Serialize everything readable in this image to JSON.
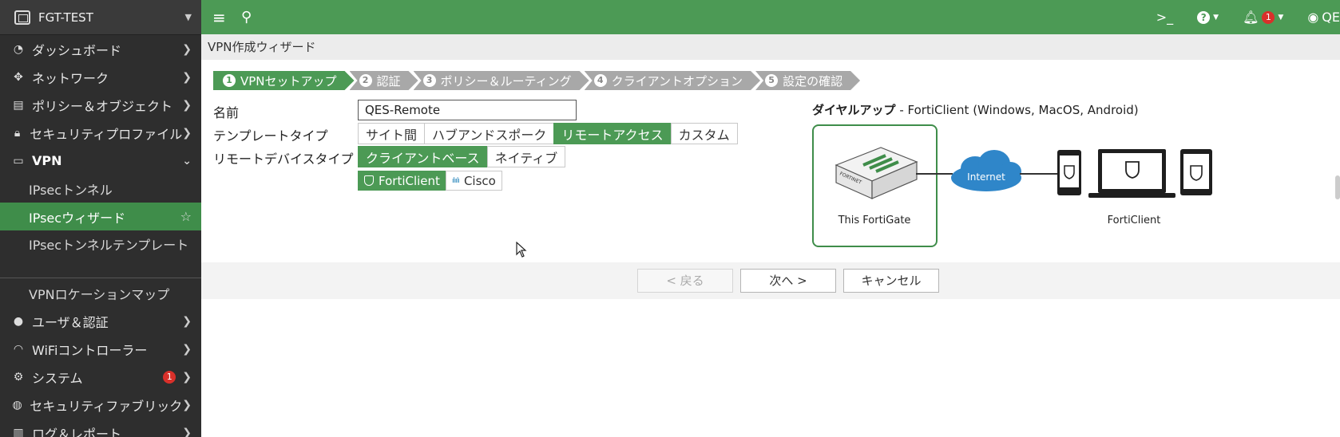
{
  "sidebar": {
    "device_name": "FGT-TEST",
    "items": [
      {
        "label": "ダッシュボード",
        "icon": "dashboard-icon"
      },
      {
        "label": "ネットワーク",
        "icon": "network-icon"
      },
      {
        "label": "ポリシー＆オブジェクト",
        "icon": "policy-icon"
      },
      {
        "label": "セキュリティプロファイル",
        "icon": "lock-icon"
      },
      {
        "label": "VPN",
        "icon": "laptop-icon"
      },
      {
        "label": "IPsecトンネル"
      },
      {
        "label": "IPsecウィザード"
      },
      {
        "label": "IPsecトンネルテンプレート"
      },
      {
        "label": "VPNロケーションマップ"
      },
      {
        "label": "ユーザ＆認証",
        "icon": "user-icon"
      },
      {
        "label": "WiFiコントローラー",
        "icon": "wifi-icon"
      },
      {
        "label": "システム",
        "icon": "gear-icon",
        "badge": "1"
      },
      {
        "label": "セキュリティファブリック",
        "icon": "fabric-icon"
      },
      {
        "label": "ログ＆レポート",
        "icon": "chart-icon"
      }
    ]
  },
  "topbar": {
    "cli_label": ">_",
    "help_label": "?",
    "notification_count": "1",
    "user_label": "QE"
  },
  "page": {
    "title": "VPN作成ウィザード"
  },
  "steps": [
    {
      "num": "1",
      "label": "VPNセットアップ",
      "active": true
    },
    {
      "num": "2",
      "label": "認証"
    },
    {
      "num": "3",
      "label": "ポリシー＆ルーティング"
    },
    {
      "num": "4",
      "label": "クライアントオプション"
    },
    {
      "num": "5",
      "label": "設定の確認"
    }
  ],
  "form": {
    "name_label": "名前",
    "name_value": "QES-Remote",
    "template_label": "テンプレートタイプ",
    "template_options": [
      "サイト間",
      "ハブアンドスポーク",
      "リモートアクセス",
      "カスタム"
    ],
    "template_selected": "リモートアクセス",
    "remote_device_label": "リモートデバイスタイプ",
    "remote_device_options": [
      "クライアントベース",
      "ネイティブ"
    ],
    "remote_device_selected": "クライアントベース",
    "client_options": [
      "FortiClient",
      "Cisco"
    ],
    "client_selected": "FortiClient"
  },
  "diagram": {
    "title": "ダイヤルアップ",
    "subtitle": " - FortiClient (Windows, MacOS, Android)",
    "fortigate_label": "This FortiGate",
    "internet_label": "Internet",
    "client_label": "FortiClient",
    "device_brand": "FORTINET"
  },
  "footer": {
    "back_label": "< 戻る",
    "next_label": "次へ >",
    "cancel_label": "キャンセル"
  },
  "colors": {
    "accent": "#4c9a55",
    "sidebar_bg": "#2e2e2e",
    "cloud": "#2f86c9"
  }
}
